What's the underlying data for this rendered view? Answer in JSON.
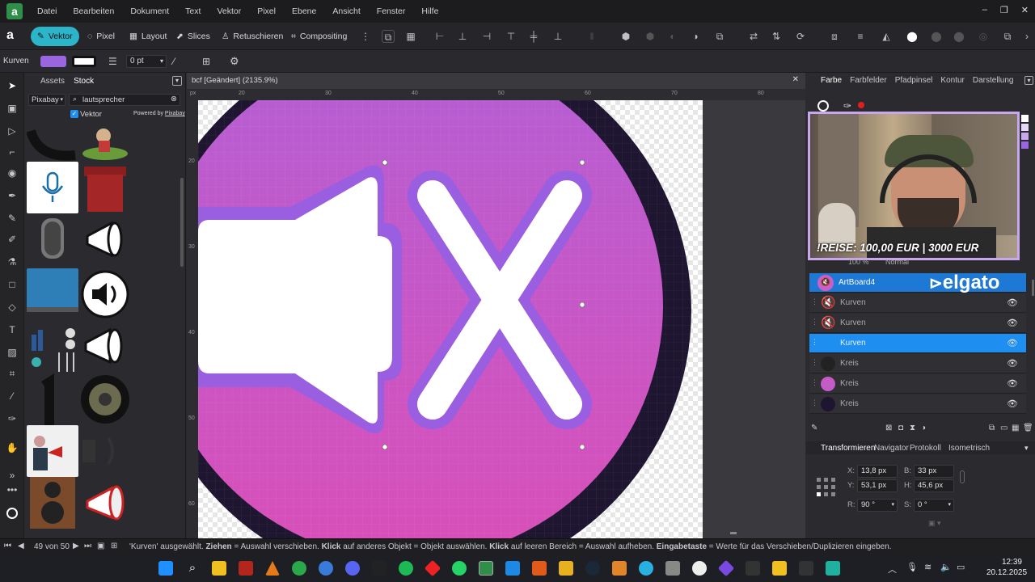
{
  "menubar": {
    "items": [
      "Datei",
      "Bearbeiten",
      "Dokument",
      "Text",
      "Vektor",
      "Pixel",
      "Ebene",
      "Ansicht",
      "Fenster",
      "Hilfe"
    ]
  },
  "personas": {
    "vektor": "Vektor",
    "pixel": "Pixel",
    "layout": "Layout",
    "slices": "Slices",
    "retuschieren": "Retuschieren",
    "compositing": "Compositing"
  },
  "context": {
    "tool_name": "Kurven",
    "stroke_width": "0 pt"
  },
  "assets": {
    "tabs": [
      "Assets",
      "Stock"
    ],
    "source": "Pixabay",
    "search_value": "lautsprecher",
    "vektor_checkbox": "Vektor",
    "powered_by": "Powered by",
    "pixabay_link": "Pixabay"
  },
  "document": {
    "title": "bcf [Geändert] (2135.9%)",
    "ruler_h": [
      "20",
      "30",
      "40",
      "50",
      "60",
      "70",
      "80"
    ],
    "ruler_v": [
      "20",
      "30",
      "40",
      "50",
      "60"
    ]
  },
  "color_panel": {
    "tabs": [
      "Farbe",
      "Farbfelder",
      "Pfadpinsel",
      "Kontur",
      "Darstellung"
    ]
  },
  "webcam": {
    "overlay_text": "!REISE: 100,00 EUR | 3000 EUR",
    "brand": "elgato"
  },
  "layers": {
    "opacity": "100 %",
    "blend": "Normal",
    "items": [
      {
        "name": "ArtBoard4"
      },
      {
        "name": "Kurven"
      },
      {
        "name": "Kurven"
      },
      {
        "name": "Kurven"
      },
      {
        "name": "Kreis"
      },
      {
        "name": "Kreis"
      },
      {
        "name": "Kreis"
      }
    ]
  },
  "transform": {
    "tabs": [
      "Transformieren",
      "Navigator",
      "Protokoll",
      "Isometrisch"
    ],
    "x_label": "X:",
    "x": "13,8 px",
    "y_label": "Y:",
    "y": "53,1 px",
    "b_label": "B:",
    "b": "33 px",
    "h_label": "H:",
    "h": "45,6 px",
    "r_label": "R:",
    "r": "90 °",
    "s_label": "S:",
    "s": "0 °"
  },
  "statusbar": {
    "page": "49 von 50",
    "msg_pre": "'Kurven' ausgewählt. ",
    "msg_b1": "Ziehen",
    "msg_t1": " = Auswahl verschieben. ",
    "msg_b2": "Klick",
    "msg_t2": " auf anderes Objekt = Objekt auswählen. ",
    "msg_b3": "Klick",
    "msg_t3": " auf leeren Bereich = Auswahl aufheben. ",
    "msg_b4": "Eingabetaste",
    "msg_t4": " = Werte für das Verschieben/Duplizieren eingeben."
  },
  "taskbar": {
    "time": "12:39",
    "date": "20.12.2025"
  },
  "colors": {
    "accent": "#2cb5c8",
    "selection": "#1e8ff0",
    "fill_purple": "#9a66e0",
    "circle_pink": "#d45bc3"
  }
}
